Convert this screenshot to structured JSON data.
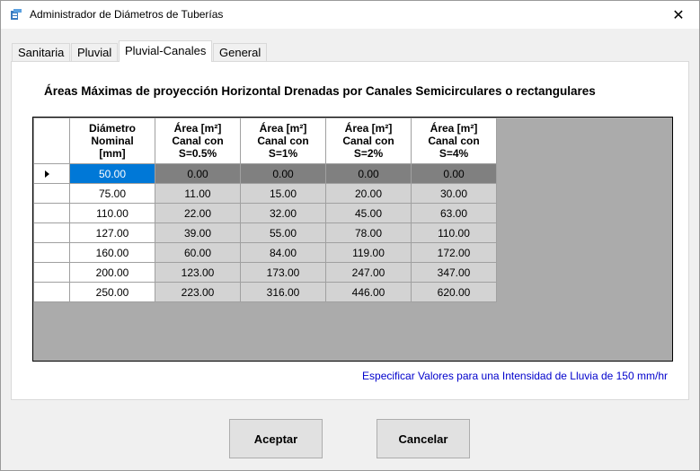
{
  "window": {
    "title": "Administrador de Diámetros de Tuberías",
    "icon": "app-pipe-icon",
    "close_glyph": "✕"
  },
  "tabs": [
    {
      "label": "Sanitaria",
      "active": false
    },
    {
      "label": "Pluvial",
      "active": false
    },
    {
      "label": "Pluvial-Canales",
      "active": true
    },
    {
      "label": "General",
      "active": false
    }
  ],
  "panel": {
    "heading": "Áreas Máximas de proyección Horizontal Drenadas por Canales Semicirculares o rectangulares",
    "note": "Especificar Valores para una Intensidad de Lluvia de 150 mm/hr"
  },
  "table": {
    "headers": [
      [
        "Diámetro",
        "Nominal",
        "[mm]"
      ],
      [
        "Área [m²]",
        "Canal con",
        "S=0.5%"
      ],
      [
        "Área [m²]",
        "Canal con",
        "S=1%"
      ],
      [
        "Área [m²]",
        "Canal con",
        "S=2%"
      ],
      [
        "Área [m²]",
        "Canal con",
        "S=4%"
      ]
    ],
    "selected_row": 0,
    "rows": [
      [
        "50.00",
        "0.00",
        "0.00",
        "0.00",
        "0.00"
      ],
      [
        "75.00",
        "11.00",
        "15.00",
        "20.00",
        "30.00"
      ],
      [
        "110.00",
        "22.00",
        "32.00",
        "45.00",
        "63.00"
      ],
      [
        "127.00",
        "39.00",
        "55.00",
        "78.00",
        "110.00"
      ],
      [
        "160.00",
        "60.00",
        "84.00",
        "119.00",
        "172.00"
      ],
      [
        "200.00",
        "123.00",
        "173.00",
        "247.00",
        "347.00"
      ],
      [
        "250.00",
        "223.00",
        "316.00",
        "446.00",
        "620.00"
      ]
    ]
  },
  "buttons": {
    "accept": "Aceptar",
    "cancel": "Cancelar"
  },
  "colors": {
    "selection": "#0078d7",
    "note_text": "#0000cc",
    "grid_background": "#ababab"
  }
}
